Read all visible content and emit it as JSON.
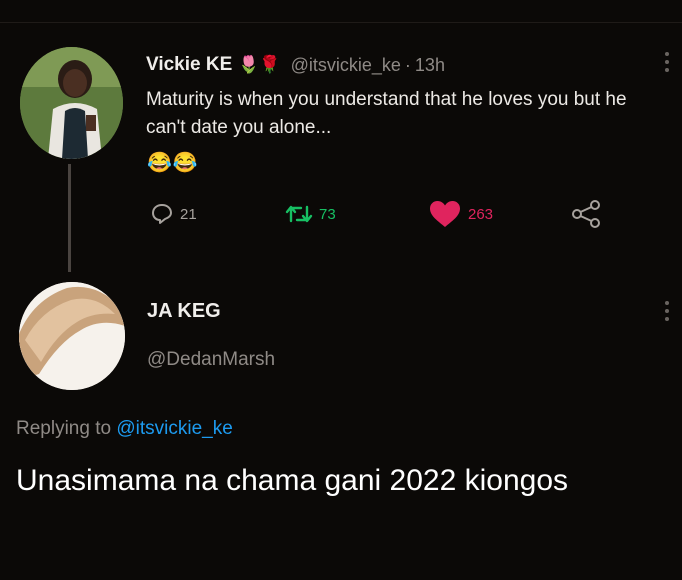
{
  "tweet": {
    "author_name": "Vickie KE",
    "author_emojis": "🌷🌹",
    "handle": "@itsvickie_ke",
    "separator": "·",
    "time": "13h",
    "text": "Maturity is when you understand that he loves you but he can't date you alone...",
    "emojis": "😂😂",
    "actions": {
      "replies": "21",
      "retweets": "73",
      "likes": "263"
    }
  },
  "reply": {
    "author_name": "JA KEG",
    "handle": "@DedanMarsh",
    "replying_prefix": "Replying to",
    "replying_handle": "@itsvickie_ke",
    "text": "Unasimama na chama gani 2022 kiongos"
  },
  "colors": {
    "background": "#0b0907",
    "retweet": "#17bf63",
    "like": "#e0245e",
    "mention": "#1d9bf0",
    "muted": "#8f8a86"
  },
  "icons": [
    "reply-icon",
    "retweet-icon",
    "heart-icon",
    "share-icon",
    "more-icon"
  ]
}
